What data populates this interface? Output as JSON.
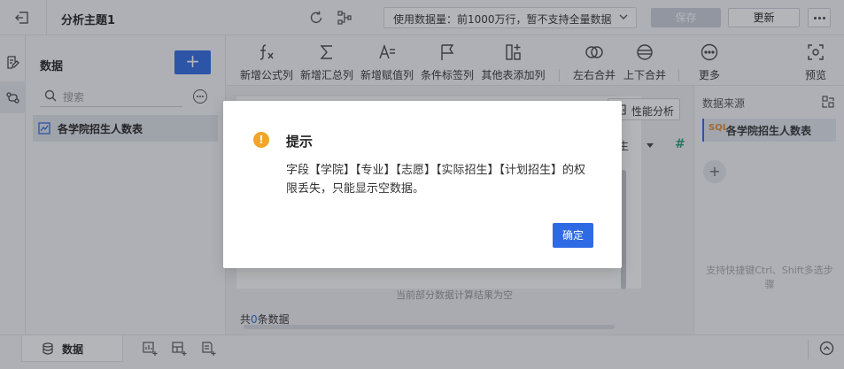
{
  "header": {
    "title": "分析主题1",
    "data_limit": "使用数据量：前1000万行，暂不支持全量数据",
    "save_label": "保存",
    "update_label": "更新"
  },
  "left_panel": {
    "title": "数据",
    "add_label": "+",
    "search_placeholder": "搜索",
    "tables": [
      "各学院招生人数表"
    ]
  },
  "toolbar": {
    "items": [
      "新增公式列",
      "新增汇总列",
      "新增赋值列",
      "条件标签列",
      "其他表添加列",
      "左右合并",
      "上下合并",
      "更多",
      "预览"
    ]
  },
  "workspace": {
    "perf_label": "性能分析",
    "column_header": "生",
    "hash_icon": "#",
    "note": "当前部分数据计算结果为空",
    "count_prefix": "共",
    "count_value": "0",
    "count_suffix": "条数据"
  },
  "right_panel": {
    "title": "数据来源",
    "source_badge": "SQL",
    "source_name": "各学院招生人数表",
    "add_label": "+",
    "hint": "支持快捷键Ctrl、Shift多选步骤"
  },
  "bottom": {
    "tab_label": "数据"
  },
  "modal": {
    "title": "提示",
    "body": "字段【学院】【专业】【志愿】【实际招生】【计划招生】的权限丢失，只能显示空数据。",
    "ok_label": "确定"
  },
  "colors": {
    "accent": "#2f6ae5",
    "warning": "#f2a529",
    "sql_badge": "#e58a2b"
  }
}
